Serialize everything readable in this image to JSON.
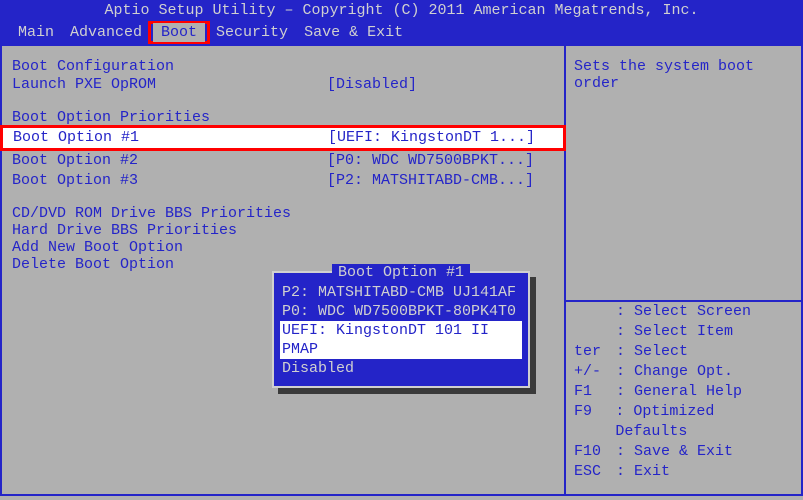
{
  "header": "Aptio Setup Utility – Copyright (C) 2011 American Megatrends, Inc.",
  "menu": {
    "items": [
      "Main",
      "Advanced",
      "Boot",
      "Security",
      "Save & Exit"
    ],
    "active_index": 2
  },
  "left": {
    "config_head": "Boot Configuration",
    "pxe_label": "Launch PXE OpROM",
    "pxe_value": "[Disabled]",
    "priorities_head": "Boot Option Priorities",
    "options": [
      {
        "label": "Boot Option #1",
        "value": "[UEFI: KingstonDT 1...]"
      },
      {
        "label": "Boot Option #2",
        "value": "[P0: WDC WD7500BPKT...]"
      },
      {
        "label": "Boot Option #3",
        "value": "[P2: MATSHITABD-CMB...]"
      }
    ],
    "cdrom": "CD/DVD ROM Drive BBS Priorities",
    "hdd": "Hard Drive BBS Priorities",
    "add": "Add New Boot Option",
    "del": "Delete Boot Option"
  },
  "popup": {
    "title": "Boot Option #1",
    "items": [
      "P2: MATSHITABD-CMB UJ141AF",
      "P0: WDC WD7500BPKT-80PK4T0",
      "UEFI: KingstonDT 101 II PMAP",
      "Disabled"
    ],
    "selected_index": 2
  },
  "help": {
    "description": "Sets the system boot order",
    "keys": [
      {
        "k": "",
        "v": ": Select Screen"
      },
      {
        "k": "",
        "v": ": Select Item"
      },
      {
        "k": "ter",
        "v": ": Select"
      },
      {
        "k": "+/-",
        "v": ": Change Opt."
      },
      {
        "k": "F1",
        "v": ": General Help"
      },
      {
        "k": "F9",
        "v": ": Optimized Defaults"
      },
      {
        "k": "F10",
        "v": ": Save & Exit"
      },
      {
        "k": "ESC",
        "v": ": Exit"
      }
    ]
  }
}
